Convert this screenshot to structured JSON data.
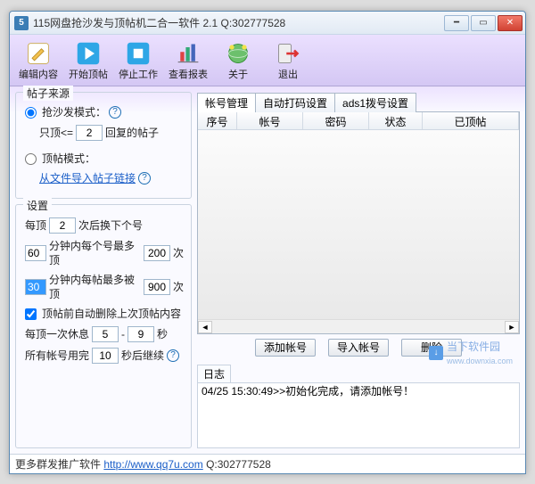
{
  "window": {
    "title": "115网盘抢沙发与顶帖机二合一软件 2.1 Q:302777528"
  },
  "toolbar": [
    {
      "name": "edit-content",
      "label": "编辑内容"
    },
    {
      "name": "start-bump",
      "label": "开始顶帖"
    },
    {
      "name": "stop-work",
      "label": "停止工作"
    },
    {
      "name": "view-report",
      "label": "查看报表"
    },
    {
      "name": "about",
      "label": "关于"
    },
    {
      "name": "exit",
      "label": "退出"
    }
  ],
  "source": {
    "title": "帖子来源",
    "mode_sofa_label": "抢沙发模式：",
    "mode_bump_label": "顶帖模式：",
    "only_bump_prefix": "只顶<=",
    "only_bump_value": "2",
    "only_bump_suffix": "回复的帖子",
    "import_link": "从文件导入帖子链接",
    "selected_mode": "sofa"
  },
  "settings": {
    "title": "设置",
    "row_change_prefix": "每顶",
    "row_change_value": "2",
    "row_change_suffix": "次后换下个号",
    "limit_acct_min": "60",
    "limit_acct_mid": "分钟内每个号最多顶",
    "limit_acct_max": "200",
    "limit_acct_suffix": "次",
    "limit_post_min": "30",
    "limit_post_mid": "分钟内每帖最多被顶",
    "limit_post_max": "900",
    "limit_post_suffix": "次",
    "auto_delete_label": "顶帖前自动删除上次顶帖内容",
    "auto_delete_checked": true,
    "rest_prefix": "每顶一次休息",
    "rest_min": "5",
    "rest_sep": "-",
    "rest_max": "9",
    "rest_suffix": "秒",
    "allused_prefix": "所有帐号用完",
    "allused_value": "10",
    "allused_suffix": "秒后继续"
  },
  "tabs": [
    "帐号管理",
    "自动打码设置",
    "ads1拨号设置"
  ],
  "active_tab": 0,
  "table": {
    "columns": [
      "序号",
      "帐号",
      "密码",
      "状态",
      "已顶帖"
    ],
    "rows": []
  },
  "buttons": {
    "add": "添加帐号",
    "import": "导入帐号",
    "delete": "删除"
  },
  "log": {
    "title": "日志",
    "lines": [
      "04/25 15:30:49>>初始化完成，请添加帐号！"
    ]
  },
  "footer": {
    "prefix": "更多群发推广软件 ",
    "url": "http://www.qq7u.com",
    "suffix": " Q:302777528"
  },
  "watermark": {
    "text": "当下软件园",
    "url": "www.downxia.com"
  }
}
